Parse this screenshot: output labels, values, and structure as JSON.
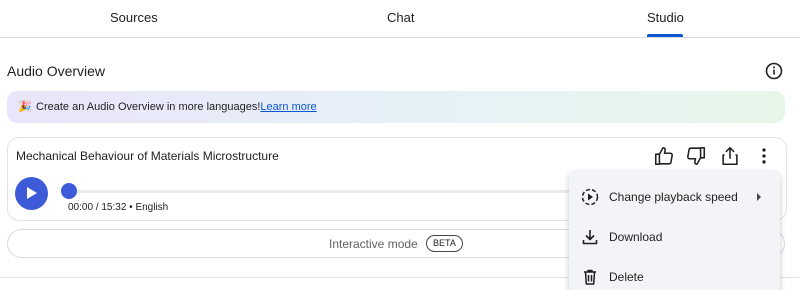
{
  "tabs": [
    {
      "label": "Sources"
    },
    {
      "label": "Chat"
    },
    {
      "label": "Studio",
      "active": true
    }
  ],
  "section": {
    "title": "Audio Overview"
  },
  "banner": {
    "emoji": "🎉",
    "text": "Create an Audio Overview in more languages!",
    "link": "Learn more"
  },
  "audio": {
    "title": "Mechanical Behaviour of Materials Microstructure",
    "current_time": "00:00",
    "duration": "15:32",
    "language": "English",
    "time_display": "00:00 / 15:32 • English",
    "progress": 0
  },
  "interactive": {
    "label": "Interactive mode",
    "badge": "BETA"
  },
  "menu": {
    "items": [
      {
        "label": "Change playback speed",
        "icon": "playback-speed-icon",
        "has_submenu": true
      },
      {
        "label": "Download",
        "icon": "download-icon"
      },
      {
        "label": "Delete",
        "icon": "trash-icon"
      }
    ]
  },
  "colors": {
    "accent": "#3d5bd9",
    "tab_indicator": "#0b57d0",
    "link": "#0b57d0"
  }
}
